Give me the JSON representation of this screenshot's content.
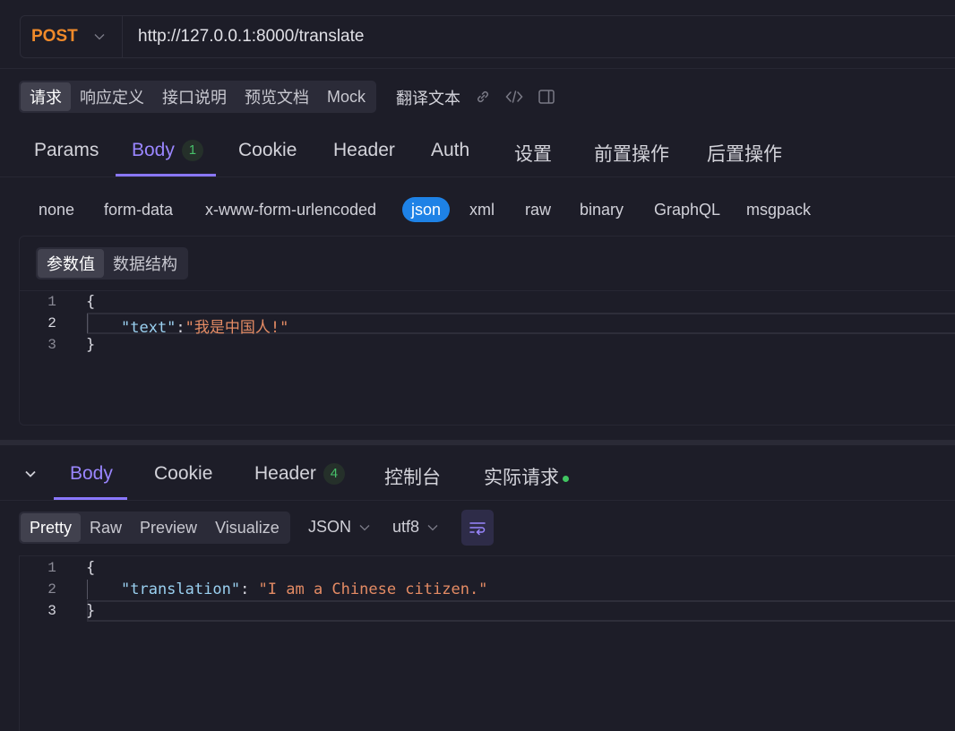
{
  "request": {
    "method": "POST",
    "url": "http://127.0.0.1:8000/translate"
  },
  "doc_tabs": [
    "请求",
    "响应定义",
    "接口说明",
    "预览文档",
    "Mock"
  ],
  "doc_tab_extra": "翻译文本",
  "request_tabs": {
    "params": "Params",
    "body": "Body",
    "body_count": "1",
    "cookie": "Cookie",
    "header": "Header",
    "auth": "Auth",
    "settings": "设置",
    "pre": "前置操作",
    "post": "后置操作"
  },
  "body_types": [
    "none",
    "form-data",
    "x-www-form-urlencoded",
    "json",
    "xml",
    "raw",
    "binary",
    "GraphQL",
    "msgpack"
  ],
  "body_type_selected": "json",
  "param_view": {
    "values": "参数值",
    "schema": "数据结构"
  },
  "request_body": {
    "line_numbers": [
      "1",
      "2",
      "3"
    ],
    "open": "{",
    "key": "\"text\"",
    "colon": ":",
    "value": "\"我是中国人!\"",
    "close": "}"
  },
  "response_tabs": {
    "body": "Body",
    "cookie": "Cookie",
    "header": "Header",
    "header_count": "4",
    "console": "控制台",
    "actual": "实际请求"
  },
  "view_modes": [
    "Pretty",
    "Raw",
    "Preview",
    "Visualize"
  ],
  "format": "JSON",
  "encoding": "utf8",
  "response_body": {
    "line_numbers": [
      "1",
      "2",
      "3"
    ],
    "open": "{",
    "key": "\"translation\"",
    "colon": ": ",
    "value": "\"I am a Chinese citizen.\"",
    "close": "}"
  },
  "colors": {
    "method": "#f08a2a",
    "accent": "#9a86ff",
    "selected_chip": "#1e82e6",
    "badge_green": "#47c06a"
  },
  "icons": [
    "chevron-down-icon",
    "link-icon",
    "code-icon",
    "panel-icon",
    "collapse-chevron-icon",
    "wrap-lines-icon"
  ]
}
